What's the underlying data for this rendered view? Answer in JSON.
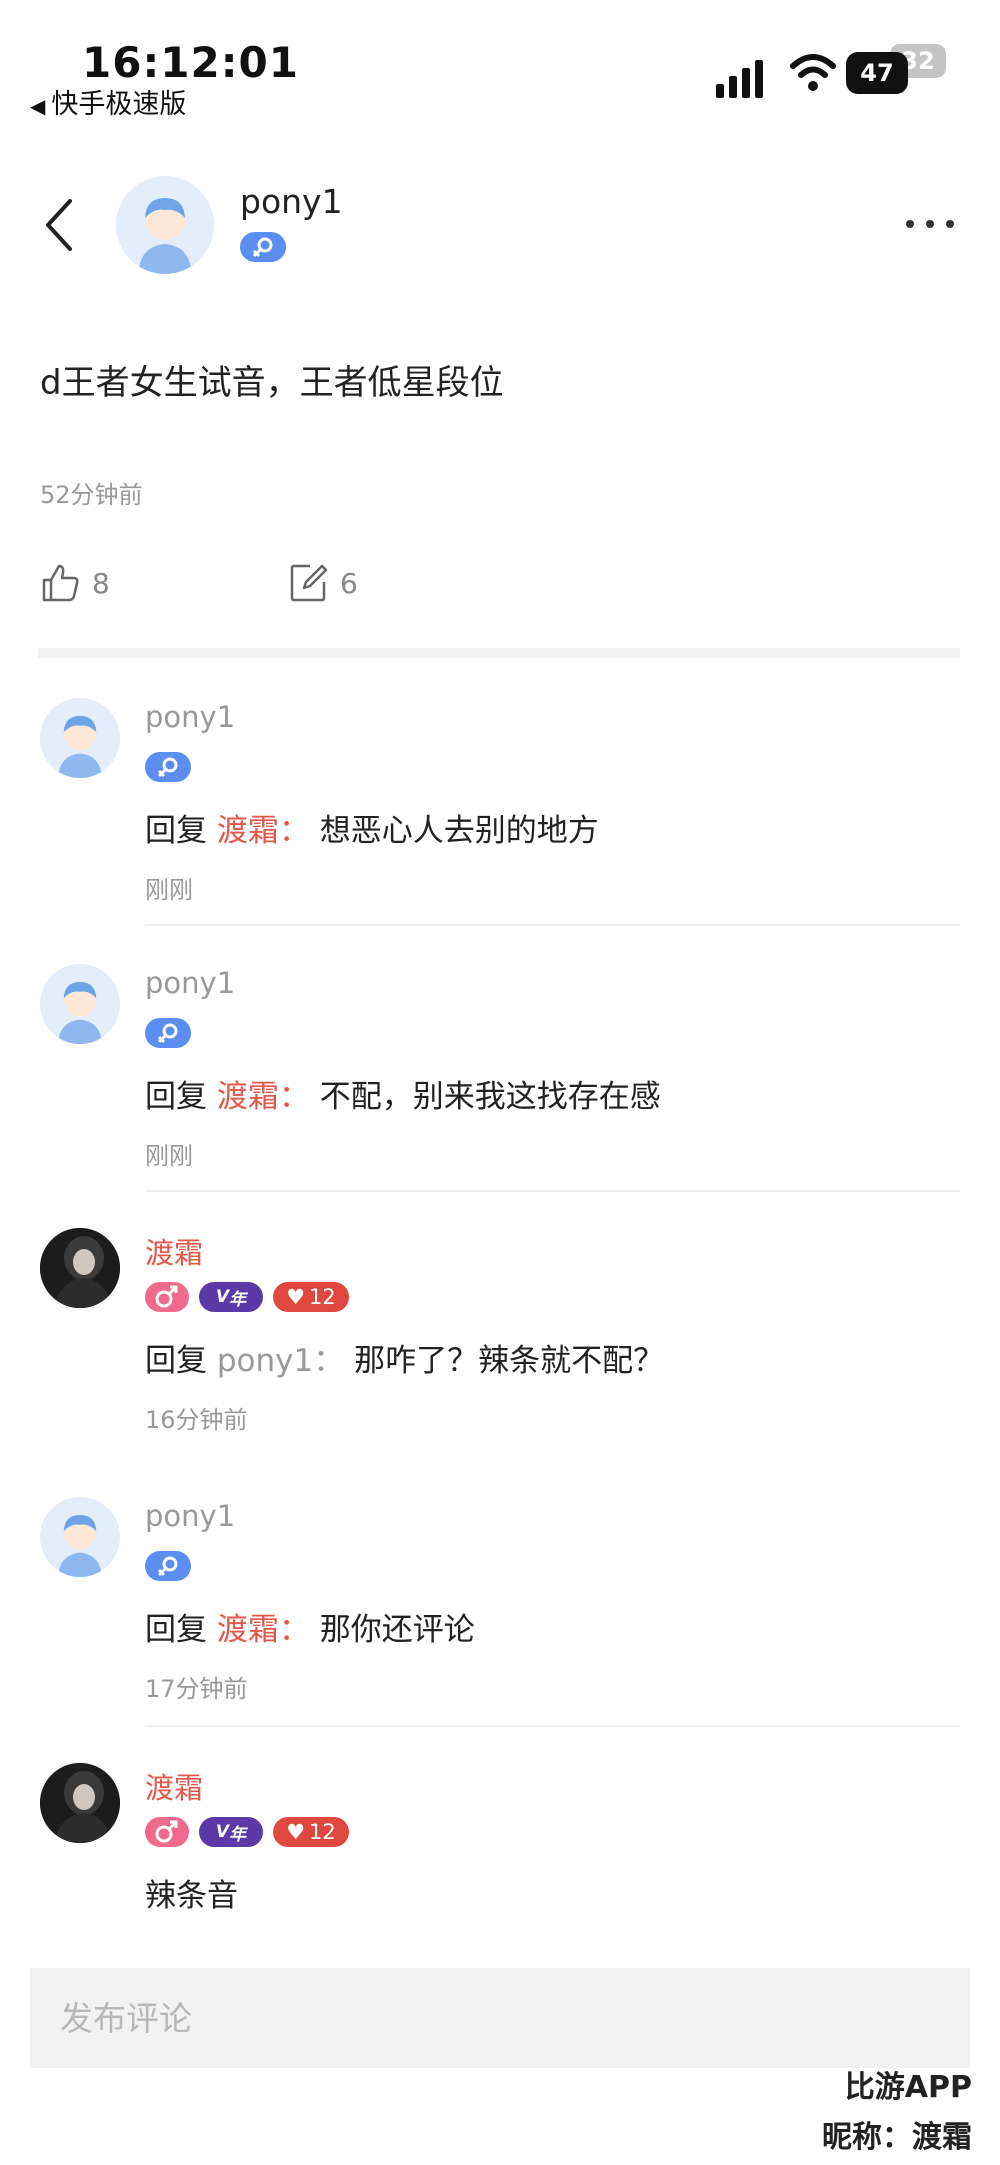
{
  "status_bar": {
    "time": "16:12:01",
    "back_app": "快手极速版",
    "battery_primary": "47",
    "battery_secondary": "32"
  },
  "post": {
    "author_name": "pony1",
    "text": "d王者女生试音，王者低星段位",
    "time": "52分钟前",
    "likes": "8",
    "comments": "6"
  },
  "comments": [
    {
      "name": "pony1",
      "reply_prefix": "回复",
      "reply_to": "渡霜：",
      "text": "想恶心人去别的地方",
      "time": "刚刚"
    },
    {
      "name": "pony1",
      "reply_prefix": "回复",
      "reply_to": "渡霜：",
      "text": "不配，别来我这找存在感",
      "time": "刚刚"
    },
    {
      "name": "渡霜",
      "vip_label": "年",
      "level": "12",
      "reply_prefix": "回复",
      "reply_to": "pony1：",
      "text": "那咋了？辣条就不配？",
      "time": "16分钟前"
    },
    {
      "name": "pony1",
      "reply_prefix": "回复",
      "reply_to": "渡霜：",
      "text": "那你还评论",
      "time": "17分钟前"
    },
    {
      "name": "渡霜",
      "vip_label": "年",
      "level": "12",
      "text": "辣条音"
    }
  ],
  "comment_input": {
    "placeholder": "发布评论"
  },
  "watermark": {
    "line1": "比游APP",
    "line2": "昵称：渡霜"
  },
  "colors": {
    "accent_red": "#e2584a",
    "female_badge": "#5b8ef0",
    "male_badge": "#f06a8e",
    "vip_badge": "#5b3aa8",
    "level_badge": "#e0473f"
  }
}
